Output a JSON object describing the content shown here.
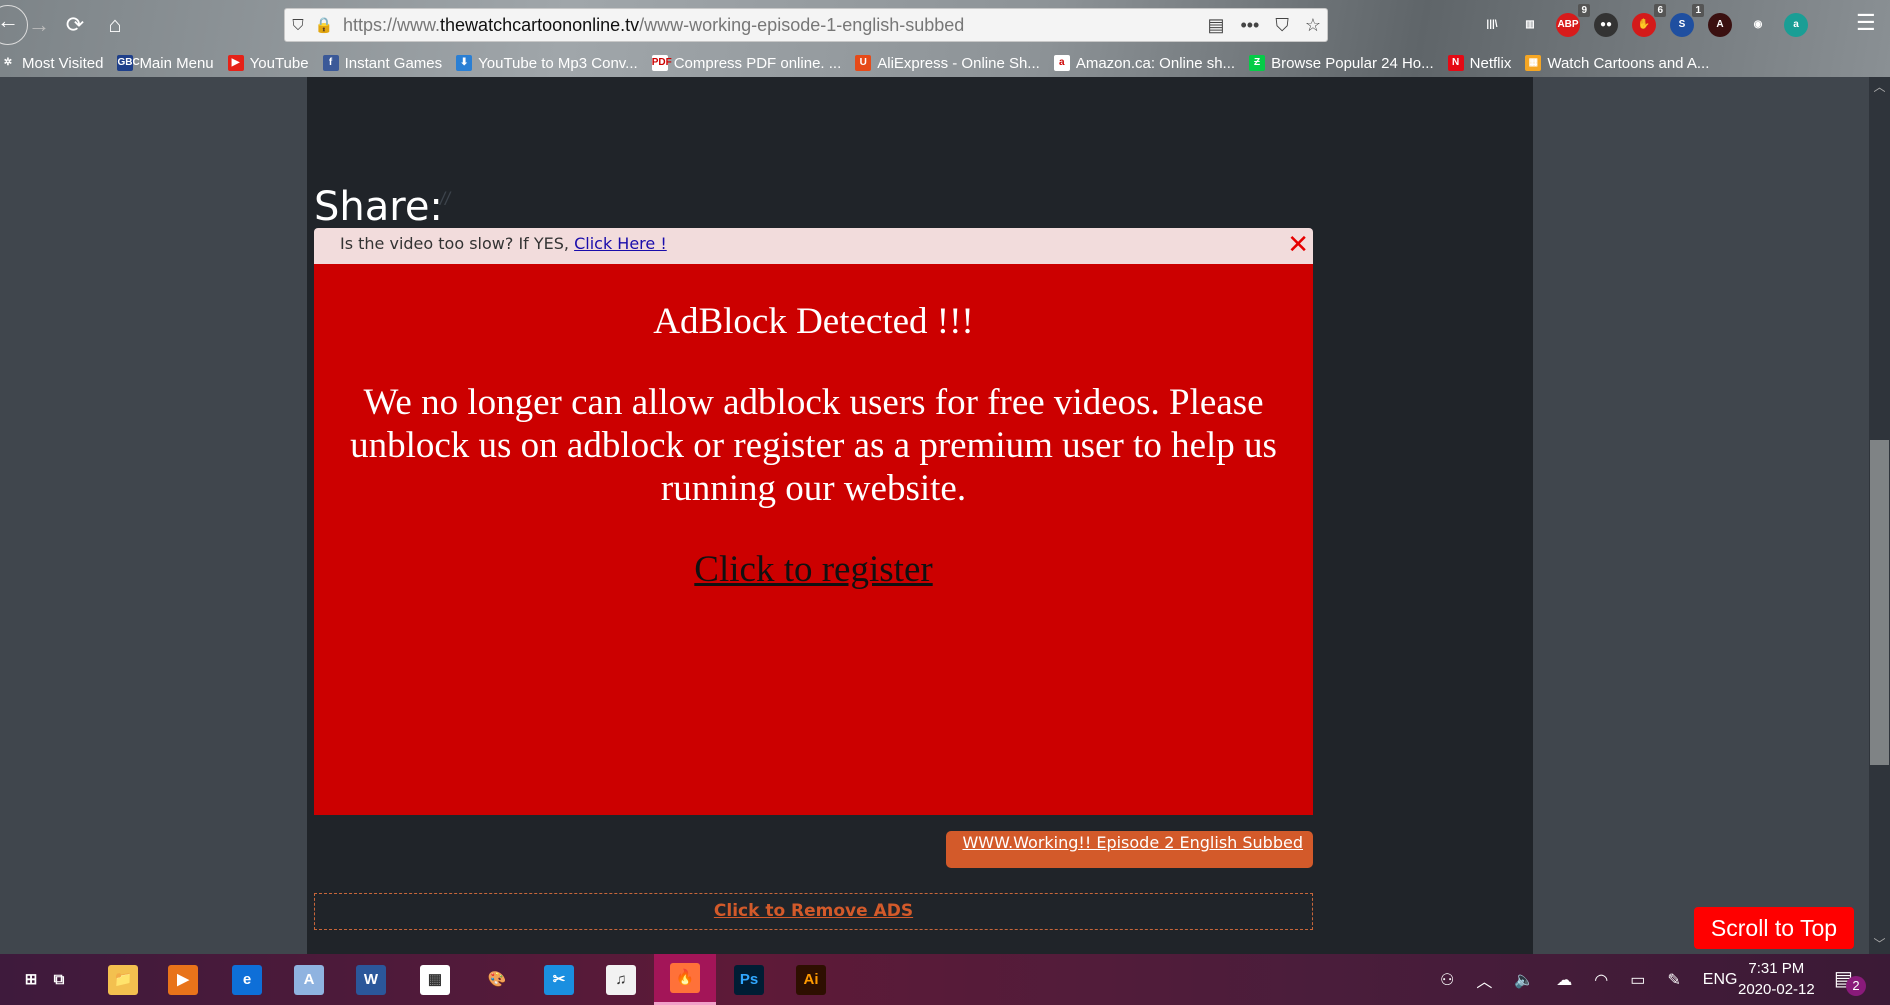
{
  "browser": {
    "url_prefix": "https://www.",
    "url_domain": "thewatchcartoononline.tv",
    "url_path": "/www-working-episode-1-english-subbed",
    "nav_icons": {
      "back": "←",
      "forward": "→",
      "reload": "⟳",
      "home": "⌂"
    },
    "url_icons": {
      "shield": "⛉",
      "lock": "🔒",
      "reader": "▤",
      "more": "•••",
      "pocket": "⛉",
      "star": "☆"
    },
    "extensions": [
      {
        "name": "library",
        "glyph": "|||\\",
        "color": "transparent",
        "badge": ""
      },
      {
        "name": "sidebar",
        "glyph": "▥",
        "color": "transparent",
        "badge": ""
      },
      {
        "name": "adblock-plus",
        "glyph": "ABP",
        "color": "#d81b1b",
        "badge": "9"
      },
      {
        "name": "dots",
        "glyph": "●●",
        "color": "#333333",
        "badge": ""
      },
      {
        "name": "ublock",
        "glyph": "✋",
        "color": "#d41a1a",
        "badge": "6"
      },
      {
        "name": "s-blocker",
        "glyph": "S",
        "color": "#1f4fa0",
        "badge": "1"
      },
      {
        "name": "acrobat",
        "glyph": "A",
        "color": "#3a1010",
        "badge": ""
      },
      {
        "name": "account",
        "glyph": "◉",
        "color": "transparent",
        "badge": ""
      },
      {
        "name": "a-extension",
        "glyph": "a",
        "color": "#1a9e95",
        "badge": ""
      }
    ],
    "menu_glyph": "☰",
    "bookmarks": [
      {
        "label": "Most Visited",
        "icon": "✲",
        "color": "transparent"
      },
      {
        "label": "Main Menu",
        "icon": "GBC",
        "color": "#1e3f8a"
      },
      {
        "label": "YouTube",
        "icon": "▶",
        "color": "#e62117"
      },
      {
        "label": "Instant Games",
        "icon": "f",
        "color": "#3b5998"
      },
      {
        "label": "YouTube to Mp3 Conv...",
        "icon": "⬇",
        "color": "#2a7fd4"
      },
      {
        "label": "Compress PDF online. ...",
        "icon": "PDF",
        "color": "#ffffff"
      },
      {
        "label": "AliExpress - Online Sh...",
        "icon": "U",
        "color": "#e64a19"
      },
      {
        "label": "Amazon.ca: Online sh...",
        "icon": "a",
        "color": "#ffffff"
      },
      {
        "label": "Browse Popular 24 Ho...",
        "icon": "Ƶ",
        "color": "#05cc47"
      },
      {
        "label": "Netflix",
        "icon": "N",
        "color": "#e50914"
      },
      {
        "label": "Watch Cartoons and A...",
        "icon": "▦",
        "color": "#f5a623"
      }
    ]
  },
  "page": {
    "share_label": "Share:",
    "share_slashes": "//",
    "notice": {
      "text": "Is the video too slow? If YES, ",
      "link": "Click Here !",
      "close": "✕"
    },
    "adblock": {
      "title": "AdBlock Detected !!!",
      "body": "We no longer can allow adblock users for free videos. Please unblock us on adblock or register as a premium user to help us running our website.",
      "register_link": "Click to register",
      "bg_color": "#cc0000"
    },
    "next_episode_link": "WWW.Working!! Episode 2 English Subbed",
    "remove_ads_link": "Click to Remove ADS",
    "scroll_to_top": "Scroll to Top",
    "scrollbar": {
      "up": "︿",
      "down": "﹀",
      "position_fraction": 0.42
    }
  },
  "taskbar": {
    "apps": [
      {
        "name": "start",
        "glyph": "⊞",
        "color": "transparent"
      },
      {
        "name": "task-view",
        "glyph": "⧉",
        "color": "transparent"
      },
      {
        "name": "file-explorer",
        "glyph": "📁",
        "color": "#f3c04f"
      },
      {
        "name": "media-player",
        "glyph": "▶",
        "color": "#e8731a"
      },
      {
        "name": "edge",
        "glyph": "e",
        "color": "#0e6fd8"
      },
      {
        "name": "wordpad",
        "glyph": "A",
        "color": "#8fb3e0"
      },
      {
        "name": "word",
        "glyph": "W",
        "color": "#2b579a"
      },
      {
        "name": "calculator",
        "glyph": "▦",
        "color": "#ffffff"
      },
      {
        "name": "paint",
        "glyph": "🎨",
        "color": "transparent"
      },
      {
        "name": "snipping-tool",
        "glyph": "✂",
        "color": "#1a8fe0"
      },
      {
        "name": "itunes",
        "glyph": "♫",
        "color": "#f2f2f2"
      },
      {
        "name": "firefox",
        "glyph": "🔥",
        "color": "#ff7139"
      },
      {
        "name": "photoshop",
        "glyph": "Ps",
        "color": "#001d34"
      },
      {
        "name": "illustrator",
        "glyph": "Ai",
        "color": "#2e0f00"
      }
    ],
    "tray": {
      "people": "⚇",
      "chevron": "︿",
      "volume": "🔈",
      "onedrive": "☁",
      "wifi": "◠",
      "battery": "▭",
      "pen": "✎",
      "language": "ENG"
    },
    "time": "7:31 PM",
    "date": "2020-02-12",
    "notifications_icon": "▤",
    "notifications_count": "2"
  }
}
